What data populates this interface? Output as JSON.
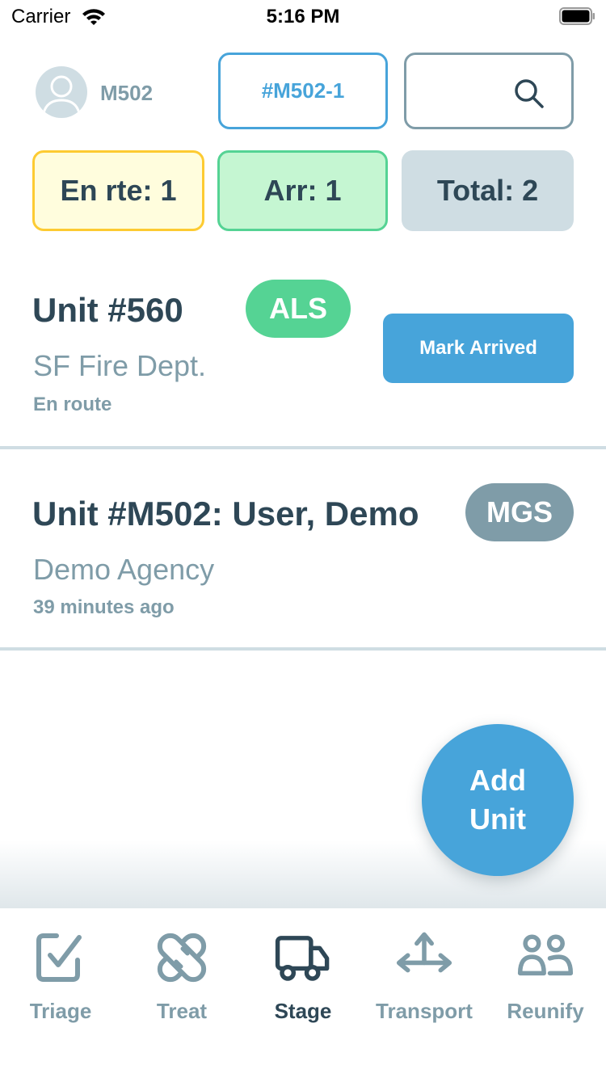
{
  "status_bar": {
    "carrier": "Carrier",
    "time": "5:16 PM",
    "icons": [
      "wifi-icon",
      "battery-icon"
    ]
  },
  "header": {
    "user_label": "M502",
    "incident_label": "#M502-1",
    "search_placeholder": "",
    "icons": {
      "avatar": "user-avatar-icon",
      "search": "search-icon"
    }
  },
  "counts": {
    "en_route": "En rte: 1",
    "arrived": "Arr: 1",
    "total": "Total: 2"
  },
  "units": [
    {
      "title": "Unit #560",
      "badge": "ALS",
      "agency": "SF Fire Dept.",
      "status": "En route",
      "action": "Mark Arrived"
    },
    {
      "title": "Unit #M502: User, Demo",
      "badge": "MGS",
      "agency": "Demo Agency",
      "status": "39 minutes ago"
    }
  ],
  "fab": {
    "line1": "Add",
    "line2": "Unit"
  },
  "tabs": [
    {
      "label": "Triage",
      "icon": "checkbox-icon",
      "active": false
    },
    {
      "label": "Treat",
      "icon": "bandage-icon",
      "active": false
    },
    {
      "label": "Stage",
      "icon": "truck-icon",
      "active": true
    },
    {
      "label": "Transport",
      "icon": "arrows-icon",
      "active": false
    },
    {
      "label": "Reunify",
      "icon": "people-icon",
      "active": false
    }
  ],
  "colors": {
    "primary": "#47a4da",
    "dark": "#2e4756",
    "muted": "#7f9ca8",
    "light": "#cfdde3",
    "green": "#55d394",
    "yellow": "#fdcb32"
  }
}
